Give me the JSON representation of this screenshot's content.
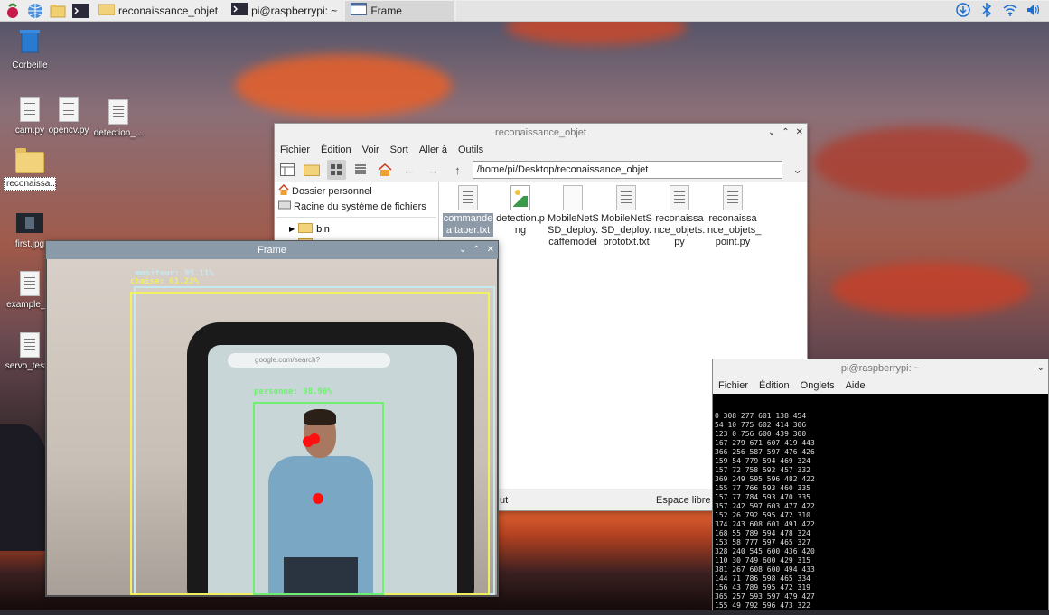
{
  "taskbar": {
    "buttons": [
      {
        "label": "reconaissance_objet",
        "icon": "folder-icon"
      },
      {
        "label": "pi@raspberrypi: ~",
        "icon": "terminal-icon"
      },
      {
        "label": "Frame",
        "icon": "window-icon"
      }
    ],
    "tray_icons": [
      "download-icon",
      "bluetooth-icon",
      "wifi-icon",
      "volume-icon"
    ]
  },
  "desktop": {
    "icons": [
      {
        "label": "Corbeille",
        "icon": "trash-icon"
      },
      {
        "label": "cam.py",
        "icon": "python-file-icon"
      },
      {
        "label": "opencv.py",
        "icon": "python-file-icon"
      },
      {
        "label": "detection_...",
        "icon": "python-file-icon"
      },
      {
        "label": "reconaissa...",
        "icon": "folder-icon"
      },
      {
        "label": "first.jpg",
        "icon": "image-file-icon"
      },
      {
        "label": "example_...",
        "icon": "python-file-icon"
      },
      {
        "label": "servo_test...",
        "icon": "python-file-icon"
      }
    ]
  },
  "file_manager": {
    "title": "reconaissance_objet",
    "menu": [
      "Fichier",
      "Édition",
      "Voir",
      "Sort",
      "Aller à",
      "Outils"
    ],
    "address": "/home/pi/Desktop/reconaissance_objet",
    "sidebar": {
      "places": [
        "Dossier personnel",
        "Racine du système de fichiers"
      ],
      "tree": [
        "bin",
        "boot"
      ]
    },
    "files": [
      {
        "label": "commande\na taper.txt",
        "icon": "text-file-icon",
        "selected": true
      },
      {
        "label": "detection.p\nng",
        "icon": "image-file-icon",
        "selected": false
      },
      {
        "label": "MobileNetS\nSD_deploy.\ncaffemodel",
        "icon": "blank-file-icon",
        "selected": false
      },
      {
        "label": "MobileNetS\nSD_deploy.\nprototxt.txt",
        "icon": "text-file-icon",
        "selected": false
      },
      {
        "label": "reconaissa\nnce_objets.\npy",
        "icon": "python-file-icon",
        "selected": false
      },
      {
        "label": "reconaissa\nnce_objets_\npoint.py",
        "icon": "python-file-icon",
        "selected": false
      }
    ],
    "status_left": "ut",
    "status_right": "Espace libre : 6"
  },
  "frame_window": {
    "title": "Frame",
    "url_text": "google.com/search?",
    "detections": [
      {
        "label": "moniteur: 95.11%",
        "color": "#c8e8f0"
      },
      {
        "label": "chaise: 61.23%",
        "color": "#f0f060"
      },
      {
        "label": "personne: 98.96%",
        "color": "#70f070"
      }
    ]
  },
  "terminal": {
    "title": "pi@raspberrypi: ~",
    "menu": [
      "Fichier",
      "Édition",
      "Onglets",
      "Aide"
    ],
    "lines": [
      "0 308 277 601 138 454",
      "54 10 775 602 414 306",
      "123 0 756 600 439 300",
      "167 279 671 607 419 443",
      "366 256 587 597 476 426",
      "159 54 779 594 469 324",
      "157 72 758 592 457 332",
      "369 249 595 596 482 422",
      "155 77 766 593 460 335",
      "157 77 784 593 470 335",
      "357 242 597 603 477 422",
      "152 26 792 595 472 310",
      "374 243 608 601 491 422",
      "168 55 789 594 478 324",
      "153 58 777 597 465 327",
      "328 240 545 600 436 420",
      "110 30 749 600 429 315",
      "381 267 608 600 494 433",
      "144 71 786 598 465 334",
      "156 43 789 595 472 319",
      "365 257 593 597 479 427",
      "155 49 792 596 473 322",
      "145 63 780 598 462 330"
    ]
  }
}
